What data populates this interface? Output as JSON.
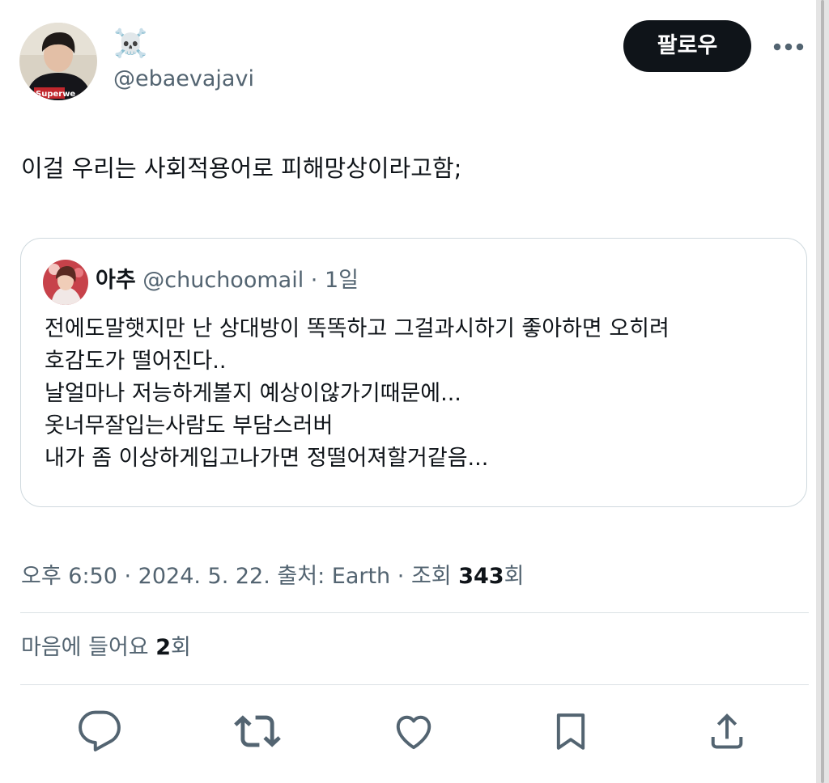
{
  "author": {
    "display_name": "☠️",
    "handle": "@ebaevajavi",
    "avatar_text": "Superwe"
  },
  "follow_label": "팔로우",
  "more_icon": "more-horizontal-icon",
  "tweet_text": "이걸 우리는 사회적용어로 피해망상이라고함;",
  "quote": {
    "display_name": "아추",
    "handle": "@chuchoomail",
    "separator": " · ",
    "time": "1일",
    "lines": [
      "전에도말햇지만  난 상대방이 똑똑하고 그걸과시하기 좋아하면 오히려",
      "호감도가 떨어진다..",
      "날얼마나 저능하게볼지 예상이않가기때문에...",
      "옷너무잘입는사람도 부담스러버",
      "내가 좀 이상하게입고나가면  정떨어져할거같음..."
    ]
  },
  "meta": {
    "time": "오후 6:50",
    "sep1": " · ",
    "date": "2024. 5. 22.",
    "source": " 출처: Earth",
    "sep2": " · ",
    "views_prefix": "조회 ",
    "views_count": "343",
    "views_suffix": "회"
  },
  "likes": {
    "prefix": "마음에 들어요 ",
    "count": "2",
    "suffix": "회"
  },
  "actions": [
    "reply-icon",
    "retweet-icon",
    "like-icon",
    "bookmark-icon",
    "share-icon"
  ],
  "colors": {
    "text": "#0f1419",
    "secondary": "#536471",
    "border": "#cfd9de",
    "button_bg": "#0f1419",
    "icon": "#536471"
  }
}
